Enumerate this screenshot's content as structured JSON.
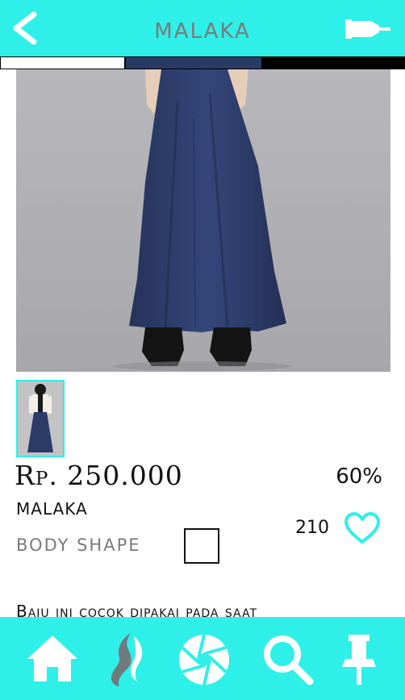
{
  "header": {
    "title": "MALAKA",
    "back_icon": "chevron-left-icon",
    "right_icon": "plug-icon"
  },
  "color_options": [
    "#ffffff",
    "#2b3a64",
    "#000000"
  ],
  "product": {
    "price": "Rp. 250.000",
    "discount": "60%",
    "name": "MALAKA",
    "body_shape_label": "BODY SHAPE",
    "likes": "210",
    "description": "Baju ini cocok dipakai pada saat"
  },
  "bottom_nav": [
    {
      "icon": "home-icon"
    },
    {
      "icon": "body-silhouette-icon"
    },
    {
      "icon": "camera-shutter-icon"
    },
    {
      "icon": "search-icon"
    },
    {
      "icon": "pin-icon"
    }
  ],
  "colors": {
    "accent": "#2ef0e8",
    "title_gray": "#7a7a7a"
  }
}
